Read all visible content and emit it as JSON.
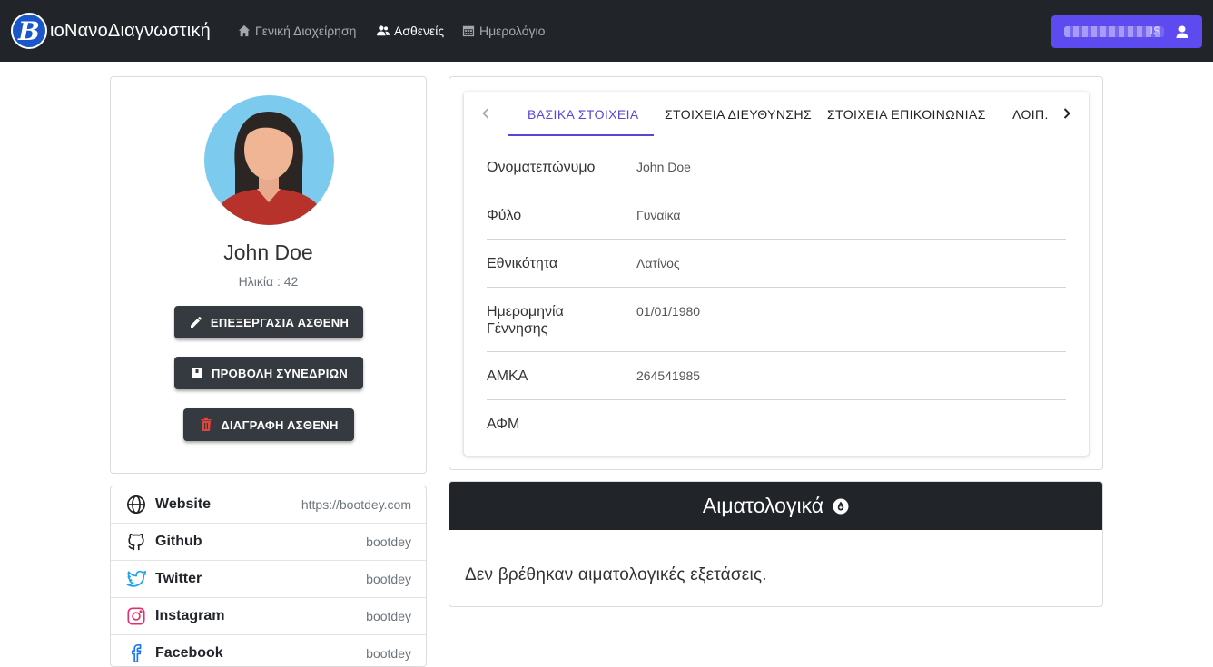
{
  "navbar": {
    "brand_letter": "B",
    "brand_text": "ιοΝανοΔιαγνωστική",
    "links": [
      {
        "label": "Γενική Διαχείρηση",
        "icon": "home-icon",
        "active": false
      },
      {
        "label": "Ασθενείς",
        "icon": "users-icon",
        "active": true
      },
      {
        "label": "Ημερολόγιο",
        "icon": "calendar-icon",
        "active": false
      }
    ],
    "user_button": {
      "label_partial": "IS",
      "icon": "user-icon"
    },
    "accent_color": "#5e4bf0"
  },
  "profile": {
    "name": "John Doe",
    "age_text": "Ηλικία : 42",
    "buttons": {
      "edit": "ΕΠΕΞΕΡΓΑΣΙΑ ΑΣΘΕΝΗ",
      "sessions": "ΠΡΟΒΟΛΗ ΣΥΝΕΔΡΙΩΝ",
      "delete": "ΔΙΑΓΡΑΦΗ ΑΣΘΕΝΗ"
    }
  },
  "social": [
    {
      "label": "Website",
      "value": "https://bootdey.com",
      "icon": "globe-icon"
    },
    {
      "label": "Github",
      "value": "bootdey",
      "icon": "github-icon"
    },
    {
      "label": "Twitter",
      "value": "bootdey",
      "icon": "twitter-icon"
    },
    {
      "label": "Instagram",
      "value": "bootdey",
      "icon": "instagram-icon"
    },
    {
      "label": "Facebook",
      "value": "bootdey",
      "icon": "facebook-icon"
    }
  ],
  "details": {
    "tabs": [
      {
        "label": "ΒΑΣΙΚΑ ΣΤΟΙΧΕΙΑ",
        "active": true
      },
      {
        "label": "ΣΤΟΙΧΕΙΑ ΔΙΕΥΘΥΝΣΗΣ",
        "active": false
      },
      {
        "label": "ΣΤΟΙΧΕΙΑ ΕΠΙΚΟΙΝΩΝΙΑΣ",
        "active": false
      },
      {
        "label": "ΛΟΙΠ.",
        "active": false
      }
    ],
    "fields": [
      {
        "label": "Ονοματεπώνυμο",
        "value": "John Doe"
      },
      {
        "label": "Φύλο",
        "value": "Γυναίκα"
      },
      {
        "label": "Εθνικότητα",
        "value": "Λατίνος"
      },
      {
        "label": "Ημερομηνία Γέννησης",
        "value": "01/01/1980"
      },
      {
        "label": "ΑΜΚΑ",
        "value": "264541985"
      },
      {
        "label": "ΑΦΜ",
        "value": ""
      }
    ]
  },
  "blood": {
    "title": "Αιματολογικά",
    "empty_message": "Δεν βρέθηκαν αιματολογικές εξετάσεις."
  }
}
